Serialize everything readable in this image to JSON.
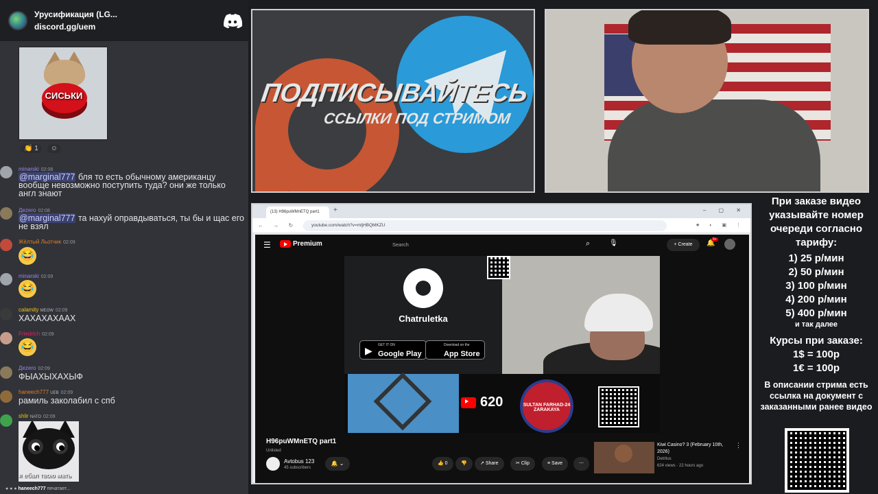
{
  "discord": {
    "server_name": "Урусификация (LG...",
    "invite": "discord.gg/uem"
  },
  "meme": {
    "caption": "СИСЬКИ"
  },
  "reactions": [
    {
      "emoji": "👏",
      "count": "1"
    },
    {
      "emoji": "☺",
      "count": ""
    }
  ],
  "messages": [
    {
      "user": "minarski",
      "time": "02:08",
      "mention": "@marginal777",
      "text": " бля то есть обычному американцу вообще невозможно поступить туда? они же только англ знают",
      "color": "#9b84ec"
    },
    {
      "user": "Дezero",
      "time": "02:08",
      "mention": "@marginal777",
      "text": " та нахуй оправдываться, ты бы и щас его не взял",
      "color": "#9b84ec"
    },
    {
      "user": "Жёлтый Льотчик",
      "time": "02:09",
      "emoji": "😂",
      "color": "#e67e22"
    },
    {
      "user": "minarski",
      "time": "02:09",
      "emoji": "😂",
      "color": "#9b84ec"
    },
    {
      "user": "calamity",
      "tag": "MEOW",
      "time": "02:09",
      "text": "ХАХАХАХААХ",
      "color": "#f1c40f"
    },
    {
      "user": "Friedrich",
      "time": "02:09",
      "emoji": "😂",
      "color": "#e91e63"
    },
    {
      "user": "Дezero",
      "time": "02:09",
      "text": "ФЫАХЫХАХЫФ",
      "color": "#9b84ec"
    },
    {
      "user": "haneech777",
      "tag": "UEB",
      "time": "02:09",
      "text": "рамиль заколабил с спб",
      "color": "#e67e22"
    },
    {
      "user": "shlir",
      "tag": "NATO",
      "time": "02:09",
      "image_caption": "я ебал твою мать",
      "color": "#f1c40f"
    }
  ],
  "typing": {
    "user": "haneech777",
    "text": "печатает..."
  },
  "promo": {
    "title": "ПОДПИСЫВАЙТЕСЬ",
    "subtitle": "ССЫЛКИ ПОД СТРИМОМ"
  },
  "browser": {
    "tab_title": "(13) H96puWMnETQ part1",
    "url": "youtube.com/watch?v=mljHBQMKZU",
    "yt_brand": "Premium",
    "search_placeholder": "Search",
    "create_label": "Create",
    "notif_badge": "9+",
    "video": {
      "app_name": "Chatruletka",
      "google_small": "GET IT ON",
      "google_big": "Google Play",
      "apple_small": "Download on the",
      "apple_big": "App Store",
      "yt_count": "620",
      "badge_text": "SULTAN FARHAD-24 ZARAKAYA"
    },
    "title": "H96puWMnETQ part1",
    "visibility": "Unlisted",
    "channel": "Avtobus 123",
    "subscribers": "45 subscribers",
    "actions": {
      "like": "0",
      "share": "Share",
      "clip": "Clip",
      "save": "Save"
    },
    "recommended": {
      "title": "Kiwi Casino? 3 (February 10th, 2026)",
      "channel": "Detritus",
      "views": "624 views",
      "age": "22 hours ago"
    }
  },
  "order_info": {
    "intro": "При заказе видео указывайте номер очереди согласно тарифу:",
    "tariffs": [
      "1) 25 р/мин",
      "2) 50 р/мин",
      "3) 100 р/мин",
      "4) 200 р/мин",
      "5) 400 р/мин"
    ],
    "etc": "и так далее",
    "rates_title": "Курсы при заказе:",
    "rates": [
      "1$ = 100р",
      "1€ = 100р"
    ],
    "description": "В описании стрима есть ссылка на документ с заказанными ранее видео"
  }
}
